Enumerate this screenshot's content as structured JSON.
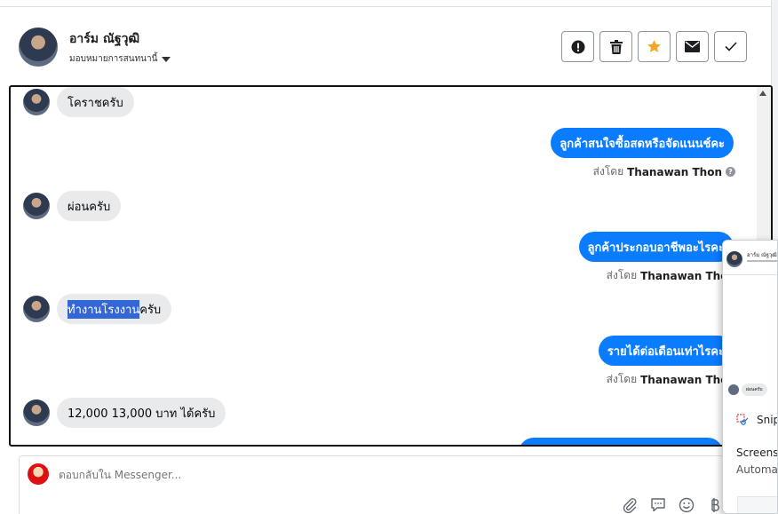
{
  "header": {
    "contact_name": "อาร์ม ณัฐวุฒิ",
    "assign_label": "มอบหมายการสนทนานี้"
  },
  "actions": [
    {
      "name": "report-button",
      "icon": "exclamation-circle-icon"
    },
    {
      "name": "delete-button",
      "icon": "trash-icon"
    },
    {
      "name": "star-button",
      "icon": "star-icon",
      "color": "#f5a623"
    },
    {
      "name": "email-button",
      "icon": "envelope-icon"
    },
    {
      "name": "done-button",
      "icon": "checkmark-icon"
    }
  ],
  "messages": {
    "m1": "โคราชครับ",
    "m2": "ลูกค้าสนใจซื้อสดหรือจัดแนนช์คะ",
    "m3": "ผ่อนครับ",
    "m4": "ลูกค้าประกอบอาชีพอะไรคะ",
    "m5_highlight": "ทำงานโรงงาน",
    "m5_rest": "ครับ",
    "m6": "รายได้ต่อเดือนเท่าไรคะ",
    "m7": "12,000 13,000 บาท ได้ครับ"
  },
  "sent_by": {
    "prefix": "ส่งโดย",
    "agent": "Thanawan Thon",
    "help": "?"
  },
  "composer": {
    "placeholder": "ตอบกลับใน Messenger..."
  },
  "popup": {
    "name": "อาร์ม ณัฐวุฒิ",
    "chip": "ผ่อนครับ",
    "app": "Snip",
    "line1": "Screens",
    "line2": "Automa"
  },
  "colors": {
    "accent": "#0a7cff",
    "selection": "#3367d6"
  }
}
